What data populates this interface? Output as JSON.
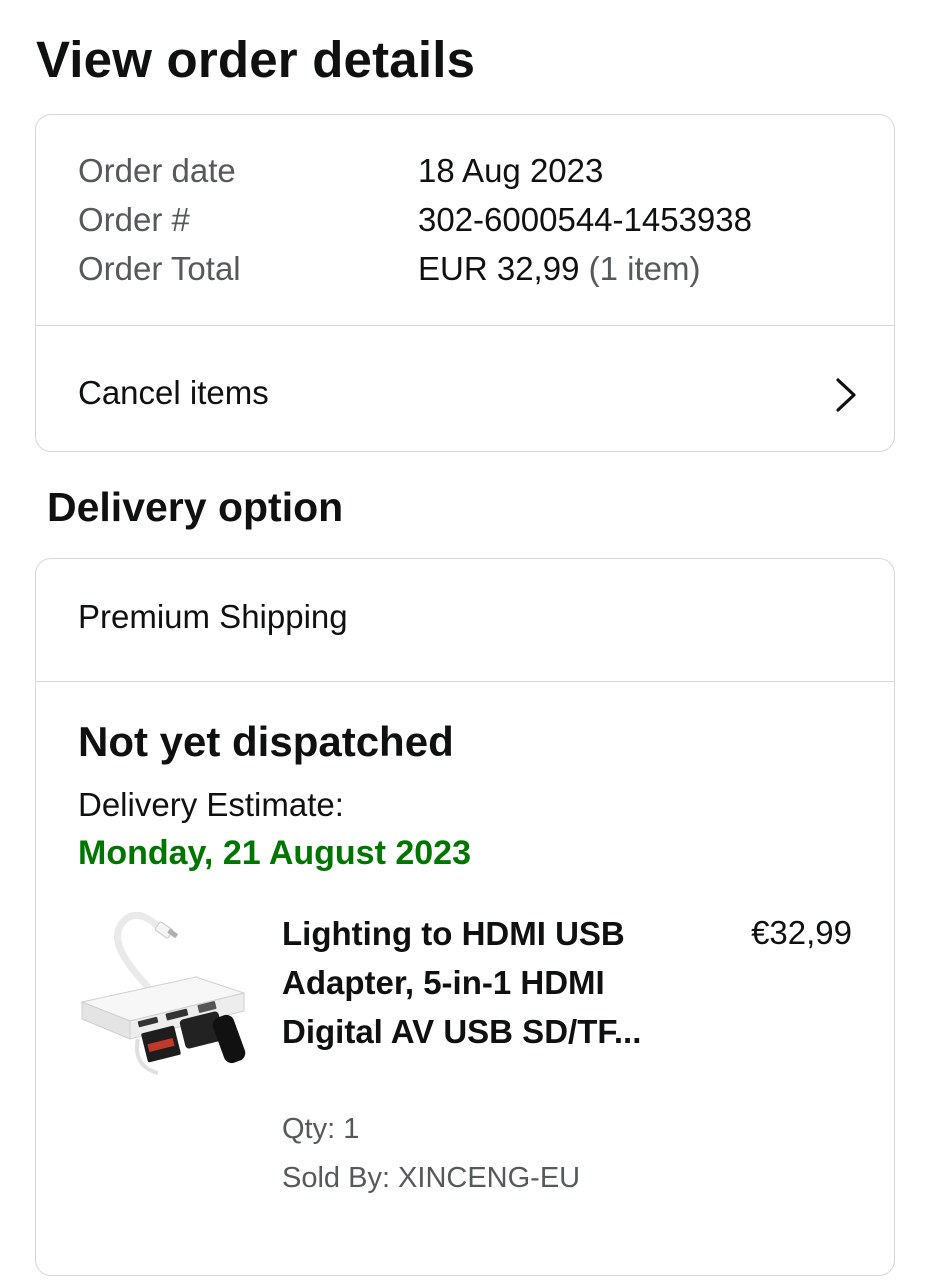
{
  "page": {
    "title": "View order details"
  },
  "summary": {
    "rows": [
      {
        "label": "Order date",
        "value": "18 Aug 2023"
      },
      {
        "label": "Order #",
        "value": "302-6000544-1453938"
      },
      {
        "label": "Order Total",
        "value": "EUR 32,99",
        "value_suffix": "(1 item)"
      }
    ],
    "cancel_label": "Cancel items"
  },
  "delivery": {
    "section_title": "Delivery option",
    "shipping_method": "Premium Shipping",
    "status": "Not yet dispatched",
    "estimate_label": "Delivery Estimate:",
    "estimate_date": "Monday, 21 August 2023",
    "estimate_color": "#007600",
    "item": {
      "title": "Lighting to HDMI USB Adapter, 5-in-1 HDMI Digital AV USB SD/TF...",
      "price": "€32,99",
      "qty": "Qty: 1",
      "seller": "Sold By: XINCENG-EU",
      "image_icon": "hdmi-usb-adapter-image"
    }
  },
  "icons": {
    "cancel_chevron": "chevron-right-icon"
  },
  "colors": {
    "text": "#0f1111",
    "muted": "#565959",
    "border": "#d5d9d9"
  }
}
